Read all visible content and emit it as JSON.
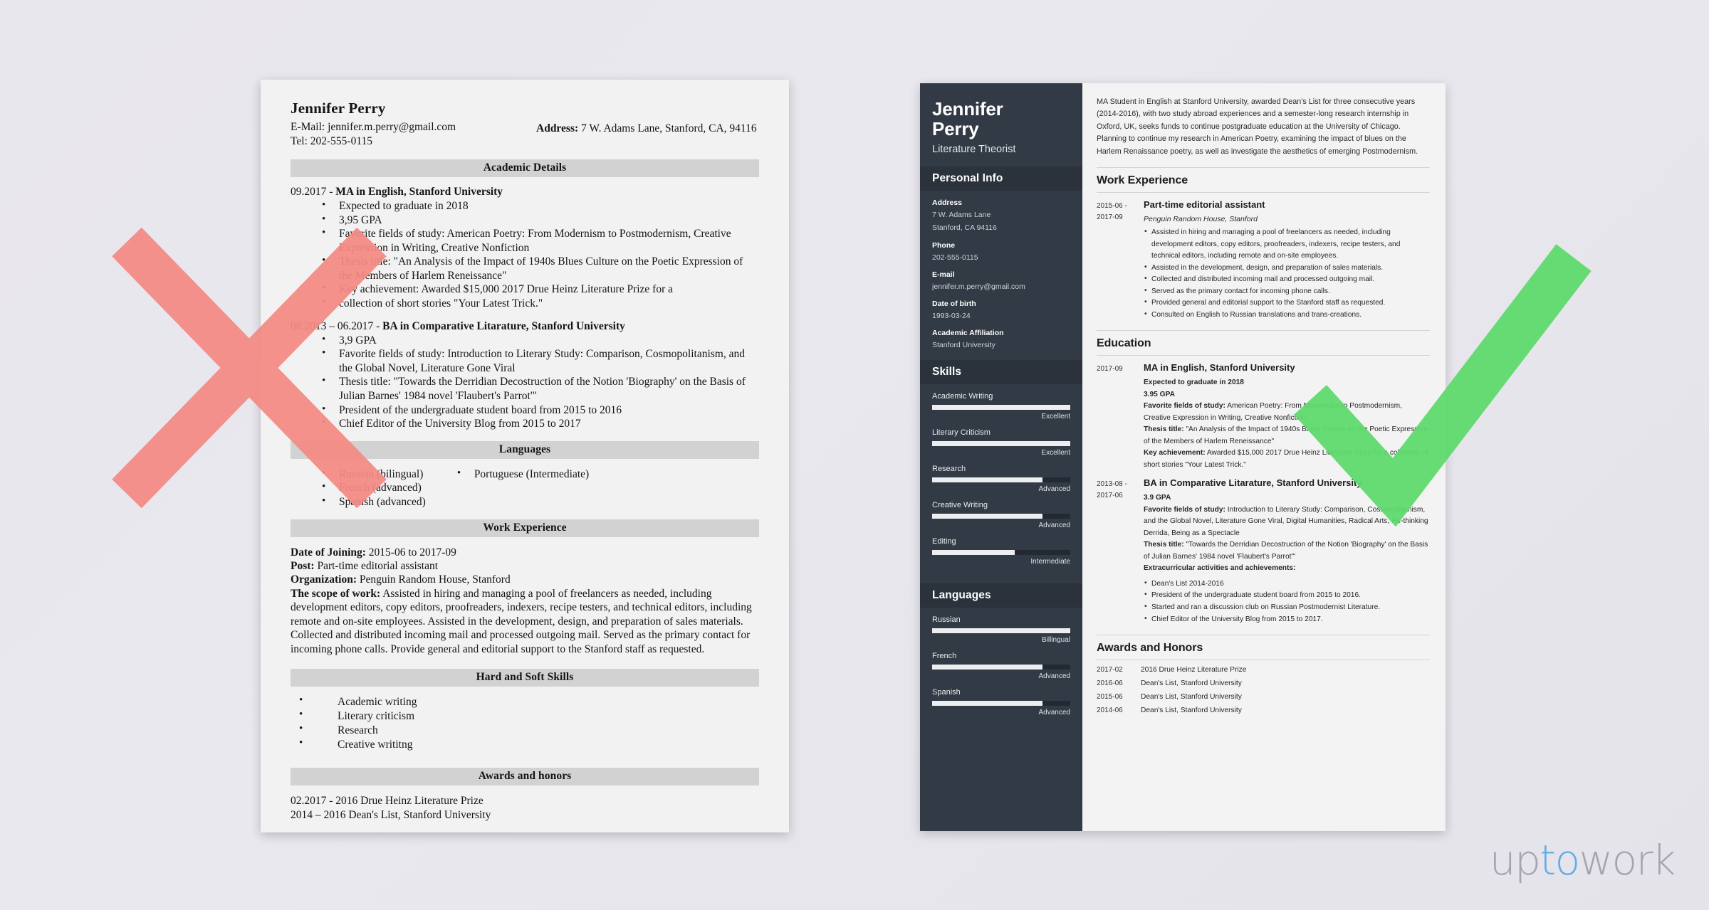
{
  "colors": {
    "page_bg": "#e7e6ec",
    "bad_paper": "#f2f2f2",
    "good_paper": "#f3f3f3",
    "sidebar": "#323a45",
    "sidebar_heading": "#2b323c",
    "band": "#d2d2d2",
    "mark_red": "#f58a84",
    "mark_green": "#5fda6d",
    "logo_gray": "#9a9aa4",
    "logo_blue": "#4aa3e8"
  },
  "bad_resume": {
    "name": "Jennifer Perry",
    "email_line": "E-Mail: jennifer.m.perry@gmail.com",
    "tel_line": "Tel: 202-555-0115",
    "address_label": "Address:",
    "address_value": "7 W. Adams Lane, Stanford, CA, 94116",
    "sections": {
      "academic": "Academic Details",
      "languages": "Languages",
      "work": "Work Experience",
      "skills": "Hard and Soft Skills",
      "awards": "Awards and honors"
    },
    "academic": [
      {
        "date": "09.2017 - ",
        "title": "MA in English, Stanford University",
        "bullets": [
          "Expected to graduate in 2018",
          "3,95 GPA",
          "Favorite fields of study: American Poetry: From Modernism to Postmodernism, Creative Expression in Writing, Creative Nonfiction",
          "Thesis title: \"An Analysis of the Impact of 1940s Blues Culture on the Poetic Expression of the Members of Harlem Reneissance\"",
          "Key achievement: Awarded $15,000 2017 Drue Heinz Literature Prize for a",
          "collection of short stories \"Your Latest Trick.\""
        ]
      },
      {
        "date": "08.2013 – 06.2017 - ",
        "title": "BA in Comparative Litarature, Stanford University",
        "bullets": [
          "3,9 GPA",
          "Favorite fields of study: Introduction to Literary Study: Comparison, Cosmopolitanism, and the Global Novel, Literature Gone Viral",
          "Thesis title: \"Towards the Derridian Decostruction of the Notion 'Biography' on the Basis of Julian Barnes' 1984 novel 'Flaubert's Parrot'\"",
          "President of the undergraduate student board from 2015 to 2016",
          "Chief Editor of the University Blog from 2015 to 2017"
        ]
      }
    ],
    "languages_left": [
      "Russian (bilingual)",
      "French (advanced)",
      "Spanish (advanced)"
    ],
    "languages_right": [
      "Portuguese (Intermediate)"
    ],
    "work": {
      "date_label": "Date of Joining:",
      "date_value": "2015-06 to 2017-09",
      "post_label": "Post:",
      "post_value": "Part-time editorial assistant",
      "org_label": "Organization:",
      "org_value": "Penguin Random House, Stanford",
      "scope_label": "The scope of work:",
      "scope_value": "Assisted in hiring and managing a pool of freelancers as needed, including development editors, copy editors, proofreaders, indexers, recipe testers, and technical editors, including remote and on-site employees. Assisted in the development, design, and preparation of sales materials. Collected and distributed incoming mail and processed outgoing mail. Served as the primary contact for incoming phone calls. Provide general and editorial support to the Stanford staff as requested."
    },
    "skills": [
      "Academic writing",
      "Literary criticism",
      "Research",
      "Creative writitng"
    ],
    "awards": [
      "02.2017 - 2016 Drue Heinz Literature Prize",
      "2014 – 2016 Dean's List, Stanford University"
    ]
  },
  "good_resume": {
    "sidebar": {
      "first_name": "Jennifer",
      "last_name": "Perry",
      "role": "Literature Theorist",
      "personal_info_title": "Personal Info",
      "fields": [
        {
          "label": "Address",
          "value": "7 W. Adams Lane\nStanford, CA 94116"
        },
        {
          "label": "Phone",
          "value": "202-555-0115"
        },
        {
          "label": "E-mail",
          "value": "jennifer.m.perry@gmail.com"
        },
        {
          "label": "Date of birth",
          "value": "1993-03-24"
        },
        {
          "label": "Academic Affiliation",
          "value": "Stanford University"
        }
      ],
      "skills_title": "Skills",
      "skills": [
        {
          "name": "Academic Writing",
          "level": "Excellent",
          "pct": 100
        },
        {
          "name": "Literary Criticism",
          "level": "Excellent",
          "pct": 100
        },
        {
          "name": "Research",
          "level": "Advanced",
          "pct": 80
        },
        {
          "name": "Creative Writing",
          "level": "Advanced",
          "pct": 80
        },
        {
          "name": "Editing",
          "level": "Intermediate",
          "pct": 60
        }
      ],
      "languages_title": "Languages",
      "languages": [
        {
          "name": "Russian",
          "level": "Billingual",
          "pct": 100
        },
        {
          "name": "French",
          "level": "Advanced",
          "pct": 80
        },
        {
          "name": "Spanish",
          "level": "Advanced",
          "pct": 80
        }
      ]
    },
    "main": {
      "summary": "MA Student in English at Stanford University, awarded Dean's List for three consecutive years (2014-2016), with two study abroad experiences and a semester-long research internship in Oxford, UK, seeks funds to continue postgraduate education at the University of Chicago. Planning to continue my research in American Poetry, examining the impact of blues on the Harlem Renaissance poetry, as well as investigate the aesthetics of emerging Postmodernism.",
      "work_title": "Work Experience",
      "work": [
        {
          "date": "2015-06 -\n2017-09",
          "title": "Part-time editorial assistant",
          "org": "Penguin Random House, Stanford",
          "bullets": [
            "Assisted in hiring and managing a pool of freelancers as needed, including development editors, copy editors, proofreaders, indexers, recipe testers, and technical editors, including remote and on-site employees.",
            "Assisted in the development, design, and preparation of sales materials.",
            "Collected and distributed incoming mail and processed outgoing mail.",
            "Served as the primary contact for incoming phone calls.",
            "Provided general and editorial support to the Stanford staff as requested.",
            "Consulted on English to Russian translations and trans-creations."
          ]
        }
      ],
      "education_title": "Education",
      "education": [
        {
          "date": "2017-09",
          "title": "MA in English, Stanford University",
          "lines": [
            {
              "bold": "Expected to graduate in 2018",
              "text": ""
            },
            {
              "bold": "3.95 GPA",
              "text": ""
            },
            {
              "bold": "Favorite fields of study:",
              "text": " American Poetry: From Modernism to Postmodernism, Creative Expression in Writing, Creative Nonfiction"
            },
            {
              "bold": "Thesis title:",
              "text": " \"An Analysis of the Impact of 1940s Blues Culture on the Poetic Expression of the Members of Harlem Reneissance\""
            },
            {
              "bold": "Key achievement:",
              "text": " Awarded $15,000 2017 Drue Heinz Literature Prize for a collection of short stories \"Your Latest Trick.\""
            }
          ],
          "bullets": []
        },
        {
          "date": "2013-08 -\n2017-06",
          "title": "BA in Comparative Litarature, Stanford University",
          "lines": [
            {
              "bold": "3.9 GPA",
              "text": ""
            },
            {
              "bold": "Favorite fields of study:",
              "text": " Introduction to Literary Study: Comparison, Cosmopolitanism, and the Global Novel, Literature Gone Viral, Digital Humanities, Radical Arts, Re-thinking Derrida, Being as a Spectacle"
            },
            {
              "bold": "Thesis title:",
              "text": " \"Towards the Derridian Decostruction of the Notion 'Biography' on the Basis of Julian Barnes' 1984 novel 'Flaubert's Parrot'\""
            },
            {
              "bold": "Extracurricular activities and achievements:",
              "text": ""
            }
          ],
          "bullets": [
            "Dean's List 2014-2016",
            "President of the undergraduate student board from 2015 to 2016.",
            "Started and ran a discussion club on Russian Postmodernist Literature.",
            "Chief Editor of the University Blog from 2015 to 2017."
          ]
        }
      ],
      "awards_title": "Awards and Honors",
      "awards": [
        {
          "date": "2017-02",
          "text": "2016 Drue Heinz Literature Prize"
        },
        {
          "date": "2016-06",
          "text": "Dean's List, Stanford University"
        },
        {
          "date": "2015-06",
          "text": "Dean's List, Stanford University"
        },
        {
          "date": "2014-06",
          "text": "Dean's List, Stanford University"
        }
      ]
    }
  },
  "marks": {
    "reject": "red-x-mark",
    "approve": "green-check-mark"
  },
  "logo": {
    "part1": "up",
    "part2": "to",
    "part3": "work"
  }
}
